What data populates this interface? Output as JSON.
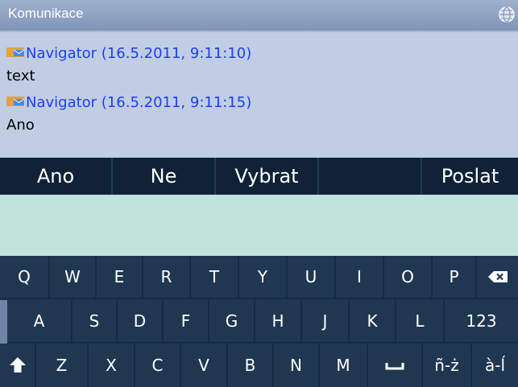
{
  "window": {
    "title": "Komunikace",
    "globe_icon": "globe-icon"
  },
  "messages": [
    {
      "sender": "Navigator (16.5.2011, 9:11:10)",
      "text": "text"
    },
    {
      "sender": "Navigator (16.5.2011, 9:11:15)",
      "text": "Ano"
    }
  ],
  "quick_buttons": {
    "ano": "Ano",
    "ne": "Ne",
    "vybrat": "Vybrat",
    "empty": "",
    "poslat": "Poslat"
  },
  "input": {
    "value": "",
    "placeholder": ""
  },
  "keyboard": {
    "row1": [
      "Q",
      "W",
      "E",
      "R",
      "T",
      "Y",
      "U",
      "I",
      "O",
      "P"
    ],
    "row2": [
      "A",
      "S",
      "D",
      "F",
      "G",
      "H",
      "J",
      "K",
      "L"
    ],
    "row2_mode": "123",
    "row3": [
      "Z",
      "X",
      "C",
      "V",
      "B",
      "N",
      "M"
    ],
    "row3_alt": [
      "ñ-ż",
      "à-ĺ"
    ],
    "icons": {
      "backspace": "backspace-icon",
      "shift": "shift-icon",
      "space": "space-icon"
    }
  },
  "colors": {
    "title_bg": "#8ea3c4",
    "messages_bg": "#c1cde3",
    "sender": "#1c3ff0",
    "quickbar_bg": "#0f2238",
    "input_bg": "#c1e3da",
    "keyboard_bg": "#203752"
  }
}
